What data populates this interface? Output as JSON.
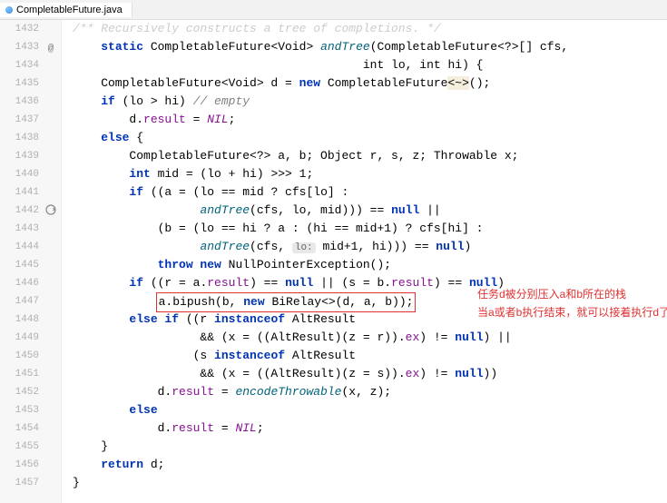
{
  "tab": {
    "filename": "CompletableFuture.java"
  },
  "gutter_start": 1432,
  "gutter_end": 1457,
  "marks": {
    "at": 1433,
    "target": 1442
  },
  "code": {
    "l1432": "/** Recursively constructs a tree of completions. */",
    "l1433_pre": "static",
    "l1433_type": " CompletableFuture<Void> ",
    "l1433_name": "andTree",
    "l1433_post": "(CompletableFuture<?>[] cfs,",
    "l1434": "                                         int lo, int hi) {",
    "l1435_pre": "    CompletableFuture<Void> d = ",
    "l1435_new": "new",
    "l1435_post1": " CompletableFuture",
    "l1435_warn": "<~>",
    "l1435_post2": "();",
    "l1436_pre": "    ",
    "l1436_if": "if",
    "l1436_cond": " (lo > hi) ",
    "l1436_comment": "// empty",
    "l1437_pre": "        d.",
    "l1437_field": "result",
    "l1437_mid": " = ",
    "l1437_nil": "NIL",
    "l1437_post": ";",
    "l1438_pre": "    ",
    "l1438_else": "else",
    "l1438_post": " {",
    "l1439": "        CompletableFuture<?> a, b; Object r, s, z; Throwable x;",
    "l1440_pre": "        ",
    "l1440_int": "int",
    "l1440_post": " mid = (lo + hi) >>> 1;",
    "l1441_pre": "        ",
    "l1441_if": "if",
    "l1441_post": " ((a = (lo == mid ? cfs[lo] :",
    "l1442_pre": "                  ",
    "l1442_call": "andTree",
    "l1442_mid": "(cfs, lo, mid))) == ",
    "l1442_null": "null",
    "l1442_post": " ||",
    "l1443": "            (b = (lo == hi ? a : (hi == mid+1) ? cfs[hi] :",
    "l1444_pre": "                  ",
    "l1444_call": "andTree",
    "l1444_mid1": "(cfs, ",
    "l1444_hint": "lo:",
    "l1444_mid2": " mid+1, hi))) == ",
    "l1444_null": "null",
    "l1444_post": ")",
    "l1445_pre": "            ",
    "l1445_throw": "throw new",
    "l1445_post": " NullPointerException();",
    "l1446_pre": "        ",
    "l1446_if": "if",
    "l1446_mid1": " ((r = a.",
    "l1446_f1": "result",
    "l1446_mid2": ") == ",
    "l1446_n1": "null",
    "l1446_mid3": " || (s = b.",
    "l1446_f2": "result",
    "l1446_mid4": ") == ",
    "l1446_n2": "null",
    "l1446_post": ")",
    "l1447_box_pre": "a.bipush(b, ",
    "l1447_new": "new",
    "l1447_box_post": " BiRelay<>(d, a, b));",
    "l1448_pre": "        ",
    "l1448_else": "else if",
    "l1448_mid": " ((r ",
    "l1448_io": "instanceof",
    "l1448_post": " AltResult",
    "l1449_pre": "                  && (x = ((AltResult)(z = r)).",
    "l1449_ex": "ex",
    "l1449_mid": ") != ",
    "l1449_null": "null",
    "l1449_post": ") ||",
    "l1450_pre": "                 (s ",
    "l1450_io": "instanceof",
    "l1450_post": " AltResult",
    "l1451_pre": "                  && (x = ((AltResult)(z = s)).",
    "l1451_ex": "ex",
    "l1451_mid": ") != ",
    "l1451_null": "null",
    "l1451_post": "))",
    "l1452_pre": "            d.",
    "l1452_f": "result",
    "l1452_mid": " = ",
    "l1452_call": "encodeThrowable",
    "l1452_post": "(x, z);",
    "l1453_pre": "        ",
    "l1453_else": "else",
    "l1454_pre": "            d.",
    "l1454_f": "result",
    "l1454_mid": " = ",
    "l1454_nil": "NIL",
    "l1454_post": ";",
    "l1455": "    }",
    "l1456_pre": "    ",
    "l1456_ret": "return",
    "l1456_post": " d;",
    "l1457": "}"
  },
  "annotation": {
    "line1": "任务d被分别压入a和b所在的栈",
    "line2": "当a或者b执行结束，就可以接着执行d了"
  },
  "icons": {
    "at_symbol": "@"
  }
}
